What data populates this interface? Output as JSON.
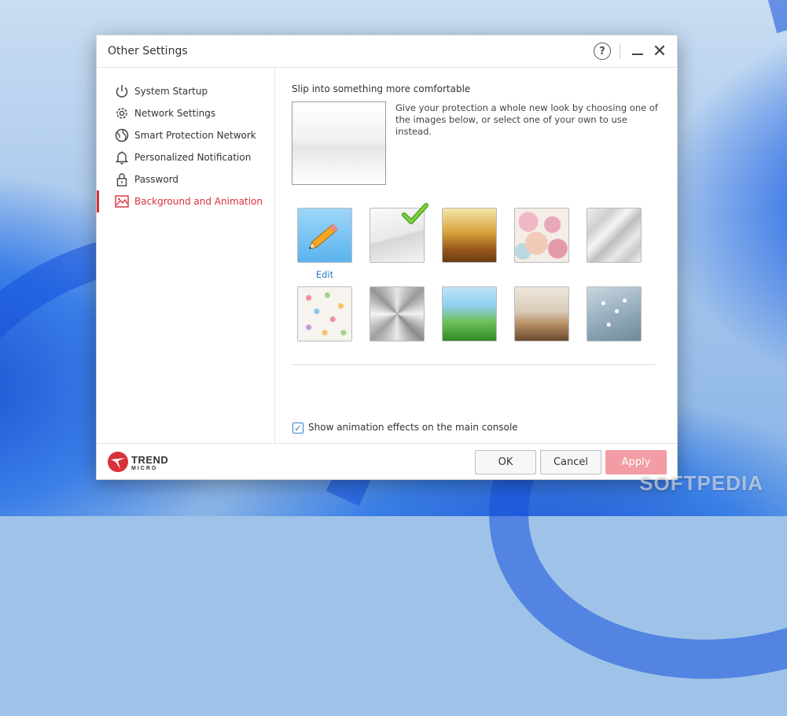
{
  "window": {
    "title": "Other Settings"
  },
  "sidebar": {
    "items": [
      {
        "label": "System Startup",
        "icon": "power-icon"
      },
      {
        "label": "Network Settings",
        "icon": "gear-icon"
      },
      {
        "label": "Smart Protection Network",
        "icon": "globe-icon"
      },
      {
        "label": "Personalized Notification",
        "icon": "bell-icon"
      },
      {
        "label": "Password",
        "icon": "lock-icon"
      },
      {
        "label": "Background and Animation",
        "icon": "picture-icon",
        "active": true
      }
    ]
  },
  "content": {
    "heading": "Slip into something more comfortable",
    "description": "Give your protection a whole new look by choosing one of the images below, or select one of your own to use instead.",
    "edit_label": "Edit",
    "selected_index": 1,
    "checkbox_label": "Show animation effects on the main console",
    "checkbox_checked": true
  },
  "footer": {
    "brand_line1": "TREND",
    "brand_line2": "MICRO",
    "ok_label": "OK",
    "cancel_label": "Cancel",
    "apply_label": "Apply"
  },
  "watermark": "SOFTPEDIA",
  "colors": {
    "accent": "#d9303a",
    "apply_disabled": "#f39ca3",
    "link": "#2a7bc8"
  }
}
